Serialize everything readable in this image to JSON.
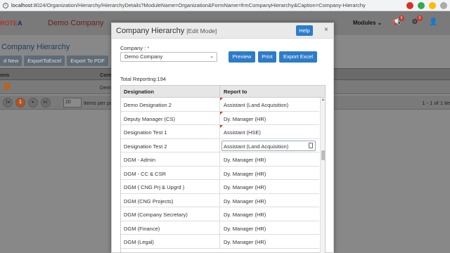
{
  "browser": {
    "url_host": "localhost",
    "url_rest": ":8024/Organization/Hierarchy/HierarchyDetails?ModuleName=Organization&FormName=frmCompanyHierarchy&Caption=Company-Hierarchy"
  },
  "app": {
    "logo_a": "ROTE",
    "logo_b": "A",
    "title": "Demo Company",
    "modules_label": "Modules",
    "notif_badge": "9",
    "settings_badge": "0"
  },
  "page": {
    "title": "Company Hierarchy",
    "toolbar": [
      "d New",
      "ExportToExcel",
      "Export To PDF"
    ],
    "table_head": [
      "ons",
      "Comp"
    ],
    "row_company": "Demo",
    "pager_current": "1",
    "page_size": "20",
    "pager_label": "items per pa",
    "pager_info": "1 - 1 of 1 ite"
  },
  "modal": {
    "title": "Company Hierarchy",
    "mode": "[Edit Mode]",
    "help_label": "Help",
    "close_label": "×",
    "company_label": "Company :",
    "required_mark": "*",
    "company_value": "Demo Company",
    "preview_label": "Preview",
    "print_label": "Print",
    "export_label": "Export Excel",
    "total_reporting": "Total Reporting:194",
    "columns": [
      "Designation",
      "Report to"
    ],
    "rows": [
      {
        "designation": "Demo Designation 2",
        "report_to": "Assistant (Land Acquisition)"
      },
      {
        "designation": "Deputy Manager (CS)",
        "report_to": "Dy. Manager (HR)"
      },
      {
        "designation": "Designation Test 1",
        "report_to": "Assistant (HSE)"
      },
      {
        "designation": "Designation Test 2",
        "report_to": "Assistant (Land Acquisition)"
      },
      {
        "designation": "DGM - Admin",
        "report_to": "Dy. Manager (HR)"
      },
      {
        "designation": "DGM - CC & CSR",
        "report_to": "Dy. Manager (HR)"
      },
      {
        "designation": "DGM ( CNG Prj & Upgrd )",
        "report_to": "Dy. Manager (HR)"
      },
      {
        "designation": "DGM (CNG Projects)",
        "report_to": "Dy. Manager (HR)"
      },
      {
        "designation": "DGM (Company Secretary)",
        "report_to": "Dy. Manager (HR)"
      },
      {
        "designation": "DGM (Finance)",
        "report_to": "Dy. Manager (HR)"
      },
      {
        "designation": "DGM (Legal)",
        "report_to": "Dy. Manager (HR)"
      }
    ]
  }
}
